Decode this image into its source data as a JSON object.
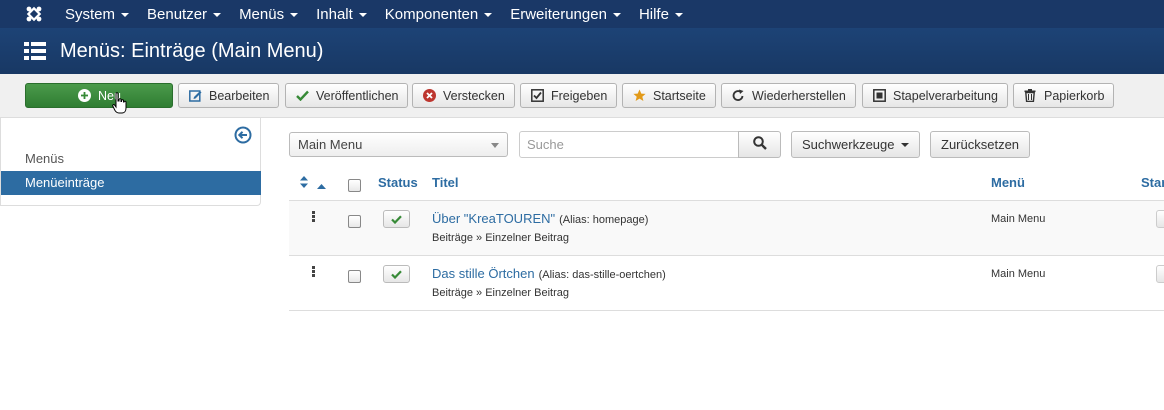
{
  "topnav": {
    "items": [
      {
        "label": "System"
      },
      {
        "label": "Benutzer"
      },
      {
        "label": "Menüs"
      },
      {
        "label": "Inhalt"
      },
      {
        "label": "Komponenten"
      },
      {
        "label": "Erweiterungen"
      },
      {
        "label": "Hilfe"
      }
    ]
  },
  "header": {
    "title": "Menüs: Einträge (Main Menu)"
  },
  "toolbar": {
    "new": "Neu",
    "edit": "Bearbeiten",
    "publish": "Veröffentlichen",
    "unpublish": "Verstecken",
    "checkin": "Freigeben",
    "home": "Startseite",
    "rebuild": "Wiederherstellen",
    "batch": "Stapelverarbeitung",
    "trash": "Papierkorb"
  },
  "sidebar": {
    "items": [
      {
        "label": "Menüs"
      },
      {
        "label": "Menüeinträge"
      }
    ]
  },
  "filters": {
    "menu_select": "Main Menu",
    "search_placeholder": "Suche",
    "search_tools": "Suchwerkzeuge",
    "reset": "Zurücksetzen"
  },
  "table": {
    "headers": {
      "status": "Status",
      "title": "Titel",
      "menu": "Menü",
      "home": "Star"
    },
    "rows": [
      {
        "title": "Über \"KreaTOUREN\"",
        "alias": "(Alias: homepage)",
        "type": "Beiträge » Einzelner Beitrag",
        "menu": "Main Menu"
      },
      {
        "title": "Das stille Örtchen",
        "alias": "(Alias: das-stille-oertchen)",
        "type": "Beiträge » Einzelner Beitrag",
        "menu": "Main Menu"
      }
    ]
  },
  "colors": {
    "topnav_bg": "#1a3867",
    "header_bg": "#1c3d70",
    "new_button": "#378a37",
    "link": "#2d6ca2",
    "sidebar_active": "#2d6ca2"
  }
}
